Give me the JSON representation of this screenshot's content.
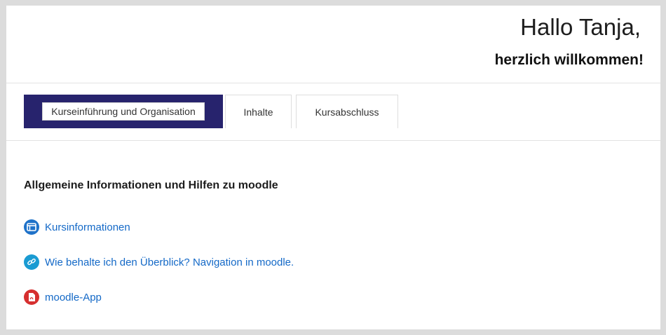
{
  "header": {
    "greeting": "Hallo Tanja,",
    "welcome": "herzlich willkommen!"
  },
  "tabs": [
    {
      "label": "Kurseinführung und Organisation",
      "active": true
    },
    {
      "label": "Inhalte",
      "active": false
    },
    {
      "label": "Kursabschluss",
      "active": false
    }
  ],
  "section": {
    "title": "Allgemeine Informationen und Hilfen zu moodle",
    "activities": [
      {
        "label": "Kursinformationen",
        "icon": "page-icon",
        "color": "#1f72c9"
      },
      {
        "label": "Wie behalte ich den Überblick? Navigation in moodle.",
        "icon": "link-icon",
        "color": "#1a9bd2"
      },
      {
        "label": "moodle-App",
        "icon": "pdf-icon",
        "color": "#d62f2f"
      }
    ]
  },
  "colors": {
    "active_tab_highlight": "#27236d",
    "link": "#1469c7"
  }
}
